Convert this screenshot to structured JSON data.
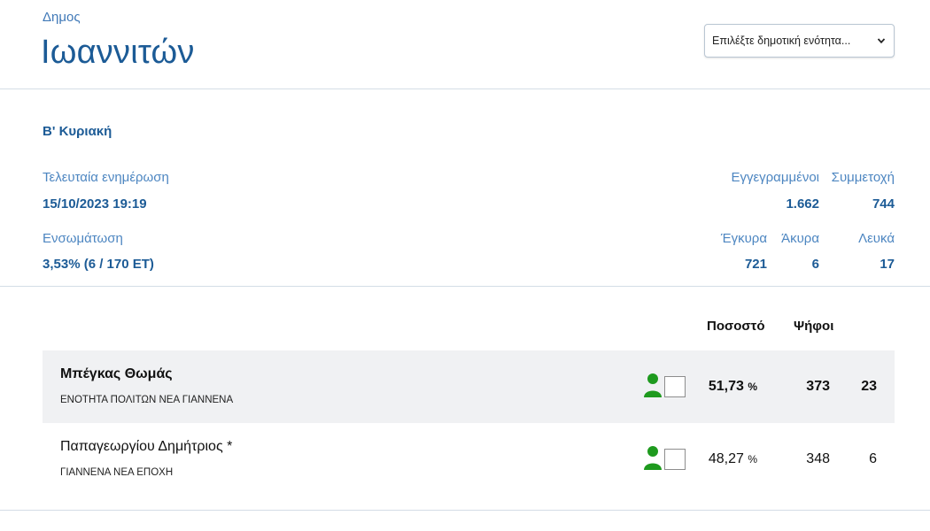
{
  "header": {
    "label": "Δημος",
    "title": "Ιωαννιτών",
    "select": {
      "value": "Επιλέξτε δημοτική ενότητα..."
    }
  },
  "round": "Β' Κυριακή",
  "meta": {
    "last_update_label": "Τελευταία ενημέρωση",
    "last_update_value": "15/10/2023 19:19",
    "integration_label": "Ενσωμάτωση",
    "integration_value": "3,53% (6 / 170 ΕΤ)",
    "registered_label": "Εγγεγραμμένοι",
    "registered_value": "1.662",
    "turnout_label": "Συμμετοχή",
    "turnout_value": "744",
    "valid_label": "Έγκυρα",
    "valid_value": "721",
    "invalid_label": "Άκυρα",
    "invalid_value": "6",
    "blank_label": "Λευκά",
    "blank_value": "17"
  },
  "table": {
    "headers": {
      "percent": "Ποσοστό",
      "votes": "Ψήφοι"
    },
    "rows": [
      {
        "name": "Μπέγκας Θωμάς",
        "party": "ΕΝΟΤΗΤΑ ΠΟΛΙΤΩΝ ΝΕΑ ΓΙΑΝΝΕΝΑ",
        "percent": "51,73",
        "percent_unit": "%",
        "votes": "373",
        "seats": "23"
      },
      {
        "name": "Παπαγεωργίου Δημήτριος *",
        "party": "ΓΙΑΝΝΕΝΑ ΝΕΑ ΕΠΟΧΗ",
        "percent": "48,27",
        "percent_unit": "%",
        "votes": "348",
        "seats": "6"
      }
    ]
  },
  "colors": {
    "accent": "#1c5b96",
    "label": "#4d86c1",
    "person_icon": "#1e9a1e",
    "row_highlight": "#f0f1f3"
  }
}
